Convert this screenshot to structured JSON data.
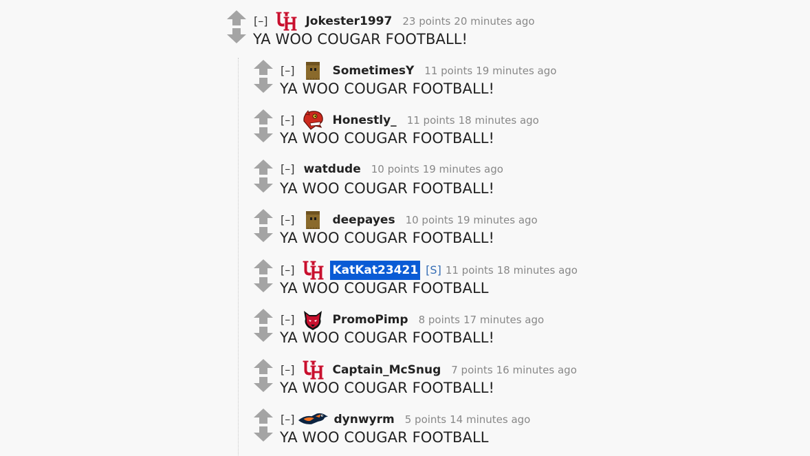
{
  "colors": {
    "op_highlight": "#0a5bd5",
    "vote_arrow": "#a4a4a4",
    "meta_text": "#888888",
    "submitter_tag": "#346cb4"
  },
  "collapse_label": "[–]",
  "comments": [
    {
      "author": "Jokester1997",
      "flair": "uh-logo-icon",
      "score": "23 points",
      "age": "20 minutes ago",
      "body": "YA WOO COUGAR FOOTBALL!"
    },
    {
      "author": "SometimesY",
      "flair": "paper-bag-icon",
      "score": "11 points",
      "age": "19 minutes ago",
      "body": "YA WOO COUGAR FOOTBALL!"
    },
    {
      "author": "Honestly_",
      "flair": "red-raptor-icon",
      "score": "11 points",
      "age": "18 minutes ago",
      "body": "YA WOO COUGAR FOOTBALL!"
    },
    {
      "author": "watdude",
      "flair": "",
      "score": "10 points",
      "age": "19 minutes ago",
      "body": "YA WOO COUGAR FOOTBALL!"
    },
    {
      "author": "deepayes",
      "flair": "paper-bag-icon",
      "score": "10 points",
      "age": "19 minutes ago",
      "body": "YA WOO COUGAR FOOTBALL!"
    },
    {
      "author": "KatKat23421",
      "flair": "uh-logo-icon",
      "submitter_tag": "[S]",
      "score": "11 points",
      "age": "18 minutes ago",
      "body": "YA WOO COUGAR FOOTBALL"
    },
    {
      "author": "PromoPimp",
      "flair": "red-wolf-icon",
      "score": "8 points",
      "age": "17 minutes ago",
      "body": "YA WOO COUGAR FOOTBALL!"
    },
    {
      "author": "Captain_McSnug",
      "flair": "uh-logo-icon",
      "score": "7 points",
      "age": "16 minutes ago",
      "body": "YA WOO COUGAR FOOTBALL!"
    },
    {
      "author": "dynwyrm",
      "flair": "roadrunner-icon",
      "score": "5 points",
      "age": "14 minutes ago",
      "body": "YA WOO COUGAR FOOTBALL"
    }
  ]
}
